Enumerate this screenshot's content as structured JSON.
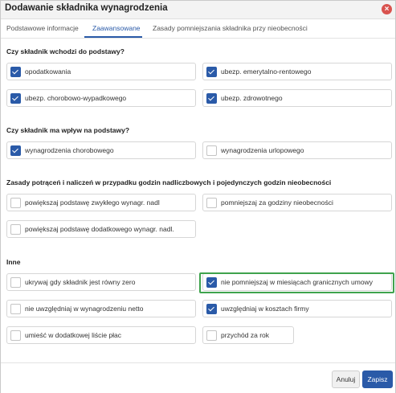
{
  "dialog": {
    "title": "Dodawanie składnika wynagrodzenia"
  },
  "tabs": [
    {
      "label": "Podstawowe informacje"
    },
    {
      "label": "Zaawansowane"
    },
    {
      "label": "Zasady pomniejszania składnika przy nieobecności"
    }
  ],
  "sections": [
    {
      "title": "Czy składnik wchodzi do podstawy?",
      "options": [
        {
          "label": "opodatkowania",
          "checked": true
        },
        {
          "label": "ubezp. emerytalno-rentowego",
          "checked": true
        },
        {
          "label": "ubezp. chorobowo-wypadkowego",
          "checked": true
        },
        {
          "label": "ubezp. zdrowotnego",
          "checked": true
        }
      ]
    },
    {
      "title": "Czy składnik ma wpływ na podstawy?",
      "options": [
        {
          "label": "wynagrodzenia chorobowego",
          "checked": true
        },
        {
          "label": "wynagrodzenia urlopowego",
          "checked": false
        }
      ]
    },
    {
      "title": "Zasady potrąceń i naliczeń w przypadku godzin nadliczbowych i pojedynczych godzin nieobecności",
      "options": [
        {
          "label": "powiększaj podstawę zwykłego wynagr. nadl",
          "checked": false
        },
        {
          "label": "pomniejszaj za godziny nieobecności",
          "checked": false
        },
        {
          "label": "powiększaj podstawę dodatkowego wynagr. nadl.",
          "checked": false
        }
      ]
    },
    {
      "title": "Inne",
      "options": [
        {
          "label": "ukrywaj gdy składnik jest równy zero",
          "checked": false
        },
        {
          "label": "nie pomniejszaj w miesiącach granicznych umowy",
          "checked": true
        },
        {
          "label": "nie uwzględniaj w wynagrodzeniu netto",
          "checked": false
        },
        {
          "label": "uwzględniaj w kosztach firmy",
          "checked": true
        },
        {
          "label": "umieść w dodatkowej liście płac",
          "checked": false
        },
        {
          "label": "przychód za rok",
          "checked": false
        }
      ]
    }
  ],
  "footer": {
    "cancel_label": "Anuluj",
    "save_label": "Zapisz"
  },
  "colors": {
    "accent": "#2a5aa8",
    "highlight": "#3fa34d",
    "close": "#d9534f"
  }
}
